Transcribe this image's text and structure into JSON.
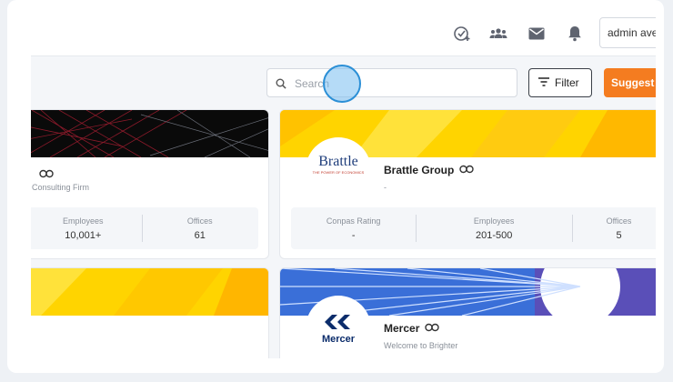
{
  "topbar": {
    "icons": [
      "task-add-icon",
      "users-icon",
      "mail-icon",
      "bell-icon"
    ],
    "user_label": "admin ave"
  },
  "toolbar": {
    "search_placeholder": "Search",
    "filter_label": "Filter",
    "suggest_label": "Suggest C"
  },
  "cards": [
    {
      "type_label": "Consulting Firm",
      "stats": [
        {
          "label": "Employees",
          "value": "10,001+"
        },
        {
          "label": "Offices",
          "value": "61"
        }
      ]
    },
    {
      "logo_text": "Brattle",
      "logo_sub": "THE POWER OF ECONOMICS",
      "name": "Brattle Group",
      "tagline": "-",
      "stats": [
        {
          "label": "Conpas Rating",
          "value": "-"
        },
        {
          "label": "Employees",
          "value": "201-500"
        },
        {
          "label": "Offices",
          "value": "5"
        }
      ]
    },
    {
      "logo_text": "Mercer",
      "name": "Mercer",
      "tagline": "Welcome to Brighter"
    }
  ],
  "colors": {
    "accent_orange": "#f47c20",
    "banner_yellow": "#ffd400",
    "banner_blue": "#3a6fd8",
    "mercer_navy": "#0b2c6b"
  }
}
